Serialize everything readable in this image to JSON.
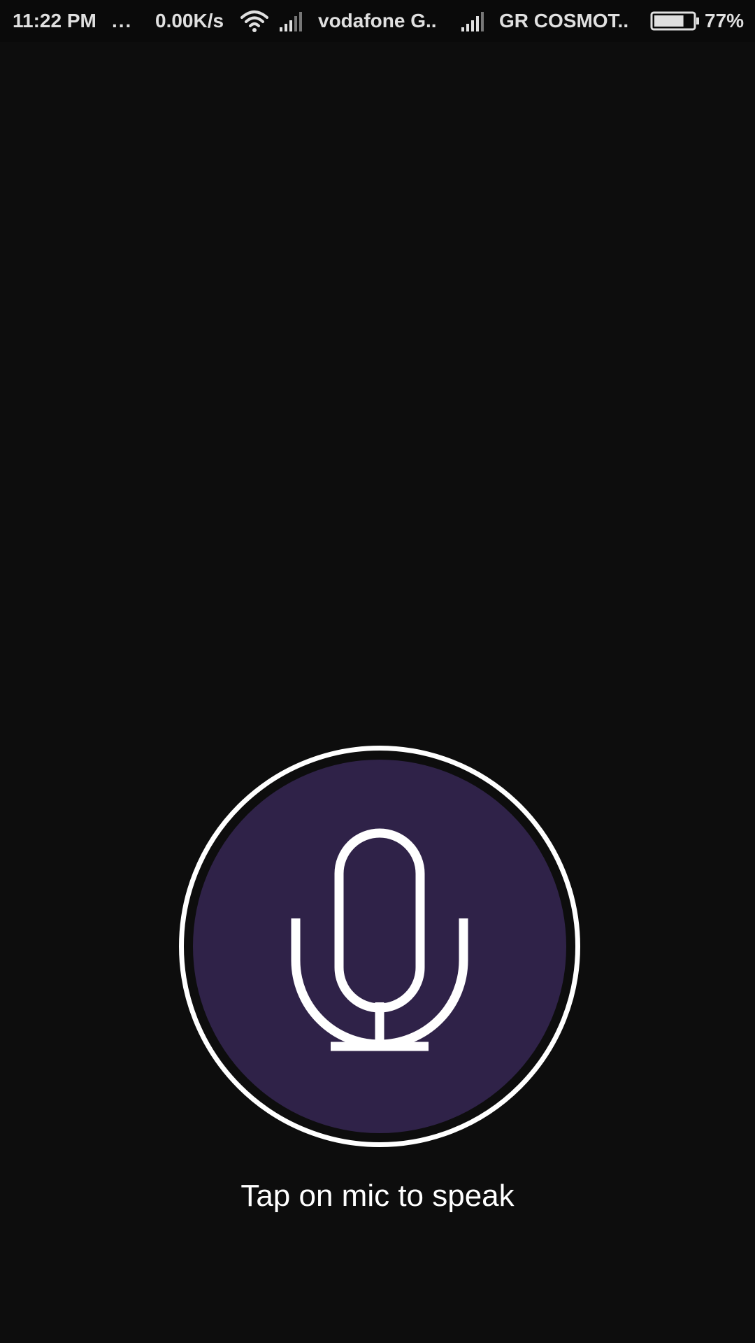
{
  "status_bar": {
    "time": "11:22 PM",
    "more_notifications": "...",
    "network_speed": "0.00K/s",
    "carrier_1": "vodafone G..",
    "carrier_2": "GR COSMOT..",
    "battery_percent": "77%",
    "battery_level": 0.77,
    "icons": [
      "wifi-icon",
      "signal-icon",
      "signal-icon",
      "battery-icon"
    ]
  },
  "voice": {
    "mic_button_icon": "microphone-icon",
    "prompt": "Tap on mic to speak"
  },
  "colors": {
    "background": "#0d0d0d",
    "mic_fill": "#2f2248",
    "mic_ring": "#ffffff"
  }
}
